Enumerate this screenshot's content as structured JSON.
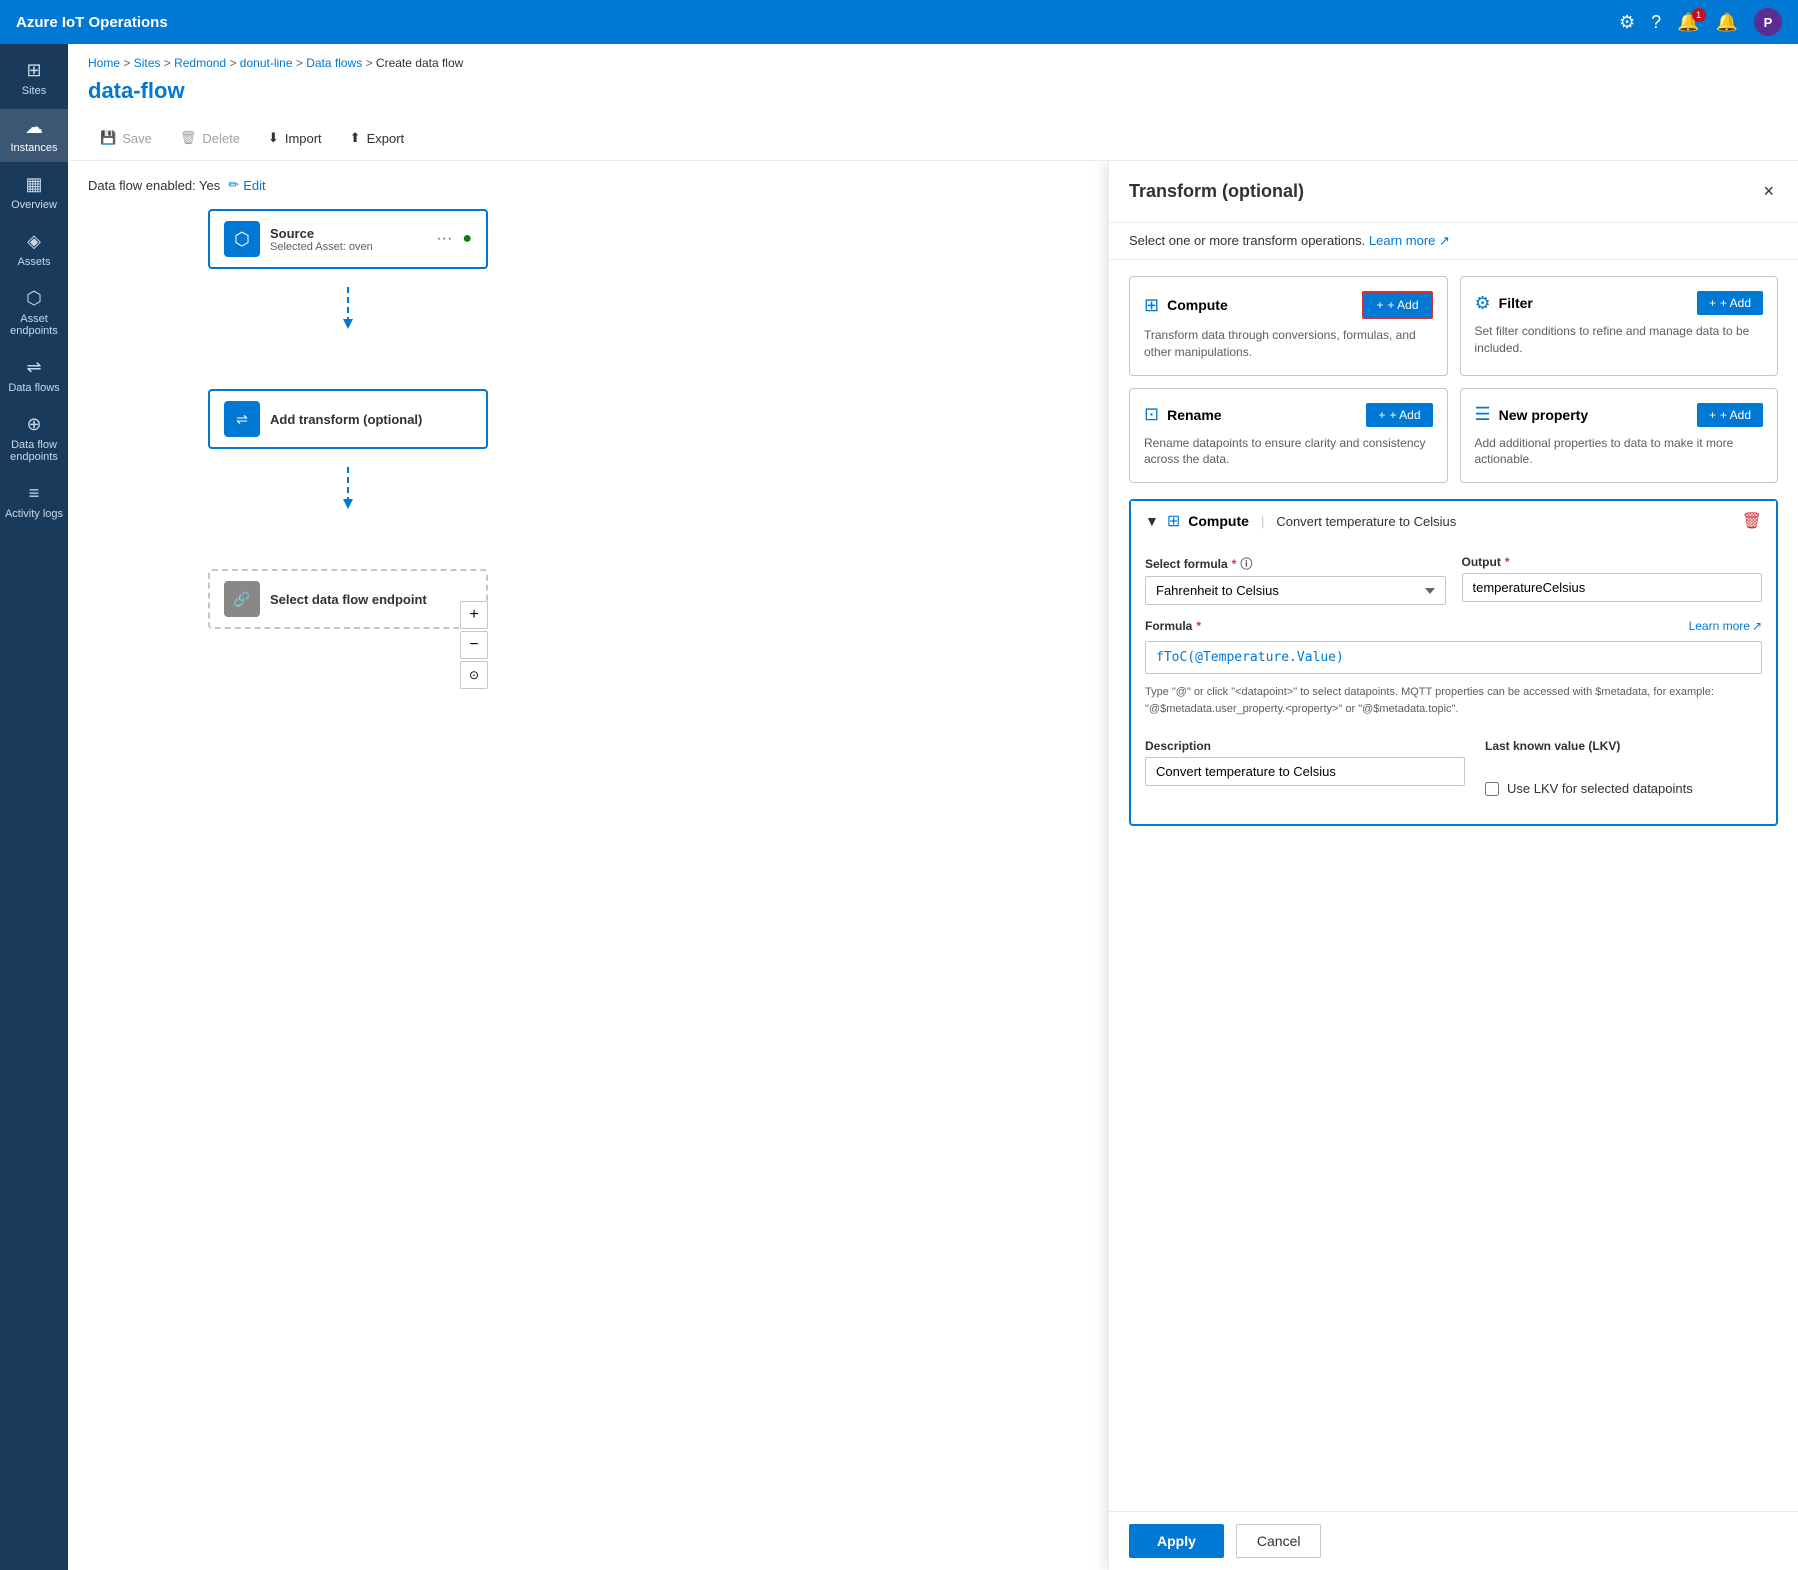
{
  "app": {
    "title": "Azure IoT Operations"
  },
  "top_nav": {
    "title": "Azure IoT Operations",
    "notification_count": "1",
    "avatar_label": "P"
  },
  "breadcrumb": {
    "items": [
      "Home",
      "Sites",
      "Redmond",
      "donut-line",
      "Data flows"
    ],
    "current": "Create data flow"
  },
  "page": {
    "title": "data-flow"
  },
  "toolbar": {
    "save_label": "Save",
    "delete_label": "Delete",
    "import_label": "Import",
    "export_label": "Export"
  },
  "dataflow_status": {
    "label": "Data flow enabled: Yes",
    "edit_label": "Edit"
  },
  "sidebar": {
    "items": [
      {
        "id": "sites",
        "label": "Sites",
        "icon": "⊞"
      },
      {
        "id": "instances",
        "label": "Instances",
        "icon": "☁"
      },
      {
        "id": "overview",
        "label": "Overview",
        "icon": "▦"
      },
      {
        "id": "assets",
        "label": "Assets",
        "icon": "◈"
      },
      {
        "id": "asset-endpoints",
        "label": "Asset endpoints",
        "icon": "⬡"
      },
      {
        "id": "data-flows",
        "label": "Data flows",
        "icon": "⇌"
      },
      {
        "id": "dataflow-endpoints",
        "label": "Data flow endpoints",
        "icon": "⊕"
      },
      {
        "id": "activity-logs",
        "label": "Activity logs",
        "icon": "≡"
      }
    ]
  },
  "flow_nodes": {
    "source": {
      "title": "Source",
      "subtitle": "Selected Asset: oven",
      "has_status": true
    },
    "transform": {
      "title": "Add transform (optional)"
    },
    "endpoint": {
      "title": "Select data flow endpoint"
    }
  },
  "panel": {
    "title": "Transform (optional)",
    "subtitle": "Select one or more transform operations.",
    "learn_more_label": "Learn more",
    "close_label": "×",
    "transform_cards": [
      {
        "id": "compute",
        "icon": "⊞",
        "title": "Compute",
        "desc": "Transform data through conversions, formulas, and other manipulations.",
        "add_label": "+ Add",
        "highlighted": true
      },
      {
        "id": "filter",
        "icon": "⚙",
        "title": "Filter",
        "desc": "Set filter conditions to refine and manage data to be included.",
        "add_label": "+ Add",
        "highlighted": false
      },
      {
        "id": "rename",
        "icon": "⊡",
        "title": "Rename",
        "desc": "Rename datapoints to ensure clarity and consistency across the data.",
        "add_label": "+ Add",
        "highlighted": false
      },
      {
        "id": "new-property",
        "icon": "☰",
        "title": "New property",
        "desc": "Add additional properties to data to make it more actionable.",
        "add_label": "+ Add",
        "highlighted": false
      }
    ],
    "compute_section": {
      "title": "Compute",
      "separator": "|",
      "subtitle": "Convert temperature to Celsius",
      "select_formula_label": "Select formula",
      "select_formula_value": "Fahrenheit to Celsius",
      "output_label": "Output",
      "output_value": "temperatureCelsius",
      "formula_label": "Formula",
      "formula_learn_more": "Learn more",
      "formula_value": "fToC(@Temperature.Value)",
      "formula_hint": "Type \"@\" or click \"<datapoint>\" to select datapoints. MQTT properties can be accessed with $metadata, for example: \"@$metadata.user_property.<property>\" or \"@$metadata.topic\".",
      "description_label": "Description",
      "description_value": "Convert temperature to Celsius",
      "lkv_label": "Last known value (LKV)",
      "lkv_checkbox_label": "Use LKV for selected datapoints",
      "lkv_checked": false
    },
    "footer": {
      "apply_label": "Apply",
      "cancel_label": "Cancel"
    }
  }
}
